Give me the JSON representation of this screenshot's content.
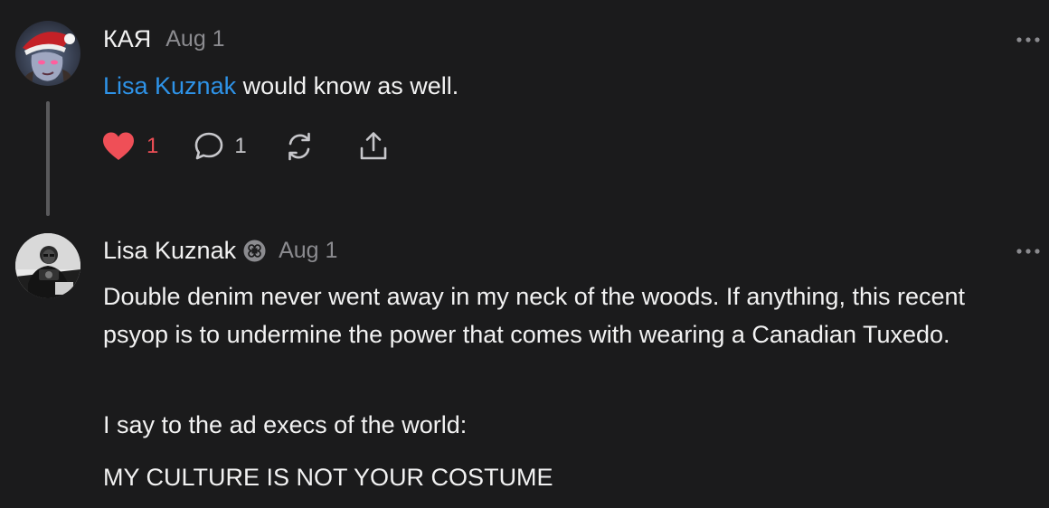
{
  "comments": [
    {
      "author": "КАЯ",
      "date": "Aug 1",
      "mention": "Lisa Kuznak",
      "text": "would know as well.",
      "likes": "1",
      "replies": "1",
      "liked": true,
      "icons": [
        "heart-icon",
        "comment-icon",
        "restack-icon",
        "share-icon",
        "more-icon"
      ]
    },
    {
      "author": "Lisa Kuznak",
      "date": "Aug 1",
      "badge_icon": "clover-badge-icon",
      "paragraphs": [
        "Double denim never went away in my neck of the woods. If anything, this recent psyop is to undermine the power that comes with wearing a Canadian Tuxedo.",
        "I say to the ad execs of the world:",
        "MY CULTURE IS NOT YOUR COSTUME"
      ]
    }
  ],
  "colors": {
    "background": "#1b1b1c",
    "mention": "#2e93e8",
    "like": "#ef4f57",
    "muted": "#8b8b8f"
  }
}
